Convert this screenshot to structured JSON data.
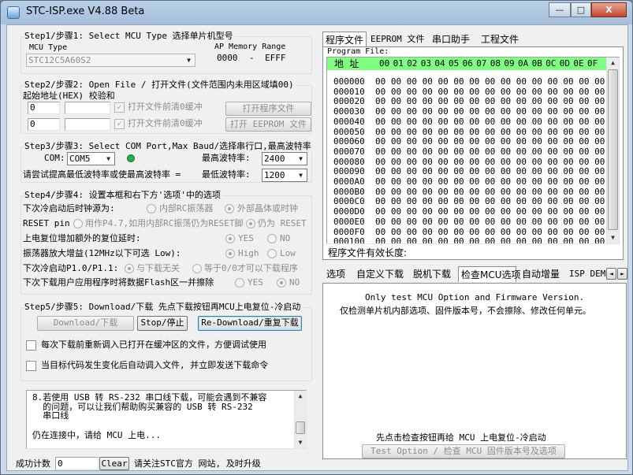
{
  "window": {
    "title": "STC-ISP.exe   V4.88 Beta",
    "btn_min": "—",
    "btn_max": "□",
    "btn_close": "X"
  },
  "step1": {
    "title": "Step1/步骤1: Select MCU Type  选择单片机型号",
    "mcu_type_label": "MCU Type",
    "mcu_value": "STC12C5A60S2",
    "ap_label": "AP Memory Range",
    "ap_start": "0000",
    "ap_dash": "-",
    "ap_end": "EFFF"
  },
  "step2": {
    "title": "Step2/步骤2: Open File / 打开文件(文件范围内未用区域填00)",
    "subtitle": "起始地址(HEX) 校验和",
    "addr1": "0",
    "addr2": "0",
    "chk1_label": "打开文件前清0缓冲",
    "chk2_label": "打开文件前清0缓冲",
    "open_program_btn": "打开程序文件",
    "open_eeprom_btn": "打开 EEPROM 文件"
  },
  "step3": {
    "title": "Step3/步骤3: Select COM Port,Max Baud/选择串行口,最高波特率",
    "com_label": "COM:",
    "com_value": "COM5",
    "max_baud_label": "最高波特率:",
    "max_baud_value": "2400",
    "try_label": "请尝试提高最低波特率或使最高波特率 =",
    "min_baud_label": "最低波特率:",
    "min_baud_value": "1200",
    "led_color": "#22b14c"
  },
  "step4": {
    "title": "Step4/步骤4: 设置本框和右下方'选项'中的选项",
    "row1": {
      "label": "下次冷启动后时钟源为:",
      "opt1": "内部RC振荡器",
      "opt2": "外部晶体或时钟"
    },
    "row2": {
      "label": "RESET pin",
      "opt1": "用作P4.7,如用内部RC振荡仍为RESET脚",
      "opt2": "仍为 RESET"
    },
    "row3": {
      "label": "上电复位增加额外的复位延时:",
      "opt1": "YES",
      "opt2": "NO"
    },
    "row4": {
      "label": "振荡器放大增益(12MHz以下可选 Low):",
      "opt1": "High",
      "opt2": "Low"
    },
    "row5": {
      "label": "下次冷启动P1.0/P1.1:",
      "opt1": "与下载无关",
      "opt2": "等于0/0才可以下载程序"
    },
    "row6": {
      "label": "下次下载用户应用程序时将数据Flash区一并擦除",
      "opt1": "YES",
      "opt2": "NO"
    }
  },
  "step5": {
    "title": "Step5/步骤5: Download/下载  先点下载按钮再MCU上电复位-冷启动",
    "download_btn": "Download/下载",
    "stop_btn": "Stop/停止",
    "redownload_btn": "Re-Download/重复下载",
    "chk1_label": "每次下载前重新调入已打开在缓冲区的文件，方便调试使用",
    "chk2_label": "当目标代码发生变化后自动调入文件, 并立即发送下载命令"
  },
  "log": {
    "line1": "8.若使用 USB 转 RS-232 串口线下载，可能会遇到不兼容",
    "line2": "  的问题，可以让我们帮助购买兼容的 USB 转 RS-232",
    "line3": "  串口线",
    "line4": "仍在连接中，请给 MCU 上电..."
  },
  "statusbar": {
    "success_label": "成功计数",
    "success_value": "0",
    "clear_btn": "Clear",
    "notice": "请关注STC官方 网站, 及时升级"
  },
  "top_tabs": [
    "程序文件",
    "EEPROM 文件",
    "串口助手",
    "工程文件"
  ],
  "program_file": {
    "label": "Program File:",
    "addr_header": "地 址",
    "columns": [
      "00",
      "01",
      "02",
      "03",
      "04",
      "05",
      "06",
      "07",
      "08",
      "09",
      "0A",
      "0B",
      "0C",
      "0D",
      "0E",
      "0F"
    ],
    "addresses": [
      "000000",
      "000010",
      "000020",
      "000030",
      "000040",
      "000050",
      "000060",
      "000070",
      "000080",
      "000090",
      "0000A0",
      "0000B0",
      "0000C0",
      "0000D0",
      "0000E0",
      "0000F0",
      "000100"
    ],
    "cell": "00",
    "header_bg": "#7fff7f",
    "valid_length_label": "程序文件有效长度:"
  },
  "bottom_tabs": [
    "选项",
    "自定义下载",
    "脱机下载",
    "检查MCU选项",
    "自动增量",
    "ISP DEMO"
  ],
  "check_mcu": {
    "line1": "Only test MCU Option and Firmware Version.",
    "line2": "仅检测单片机内部选项、固件版本号，不会擦除、修改任何单元。",
    "hint": "先点击检查按钮再给 MCU 上电复位-冷启动",
    "test_btn": "Test Option / 检查 MCU 固件版本号及选项"
  },
  "icons": {
    "dropdown": "▼",
    "scroll_up": "▲",
    "scroll_down": "▼",
    "scroll_left": "◄",
    "scroll_right": "►",
    "check": "✓"
  }
}
